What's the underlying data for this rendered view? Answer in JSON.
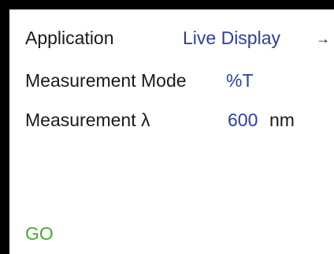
{
  "application": {
    "label": "Application",
    "value": "Live Display",
    "arrow_icon": "right-arrow-icon",
    "arrow_glyph": "→"
  },
  "measurement_mode": {
    "label": "Measurement Mode",
    "value": "%T"
  },
  "measurement_wavelength": {
    "label": "Measurement λ",
    "value": "600",
    "unit": "nm"
  },
  "go": {
    "label": "GO"
  },
  "colors": {
    "frame": "#000000",
    "background": "#ffffff",
    "label_text": "#1a1a1a",
    "value_text": "#2e3f98",
    "go_text": "#49a832"
  }
}
